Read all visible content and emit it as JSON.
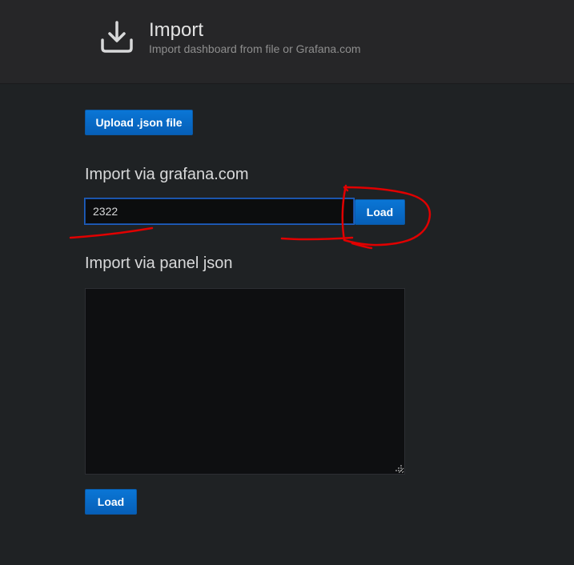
{
  "header": {
    "title": "Import",
    "subtitle": "Import dashboard from file or Grafana.com",
    "icon": "download-icon"
  },
  "upload": {
    "label": "Upload .json file"
  },
  "grafana_import": {
    "heading": "Import via grafana.com",
    "input_value": "2322",
    "load_label": "Load"
  },
  "panel_import": {
    "heading": "Import via panel json",
    "textarea_value": "",
    "load_label": "Load"
  },
  "colors": {
    "background": "#1f2224",
    "header_background": "#262628",
    "primary_button": "#0a76d6",
    "input_focus_border": "#1f60c4",
    "annotation_red": "#e00000"
  }
}
